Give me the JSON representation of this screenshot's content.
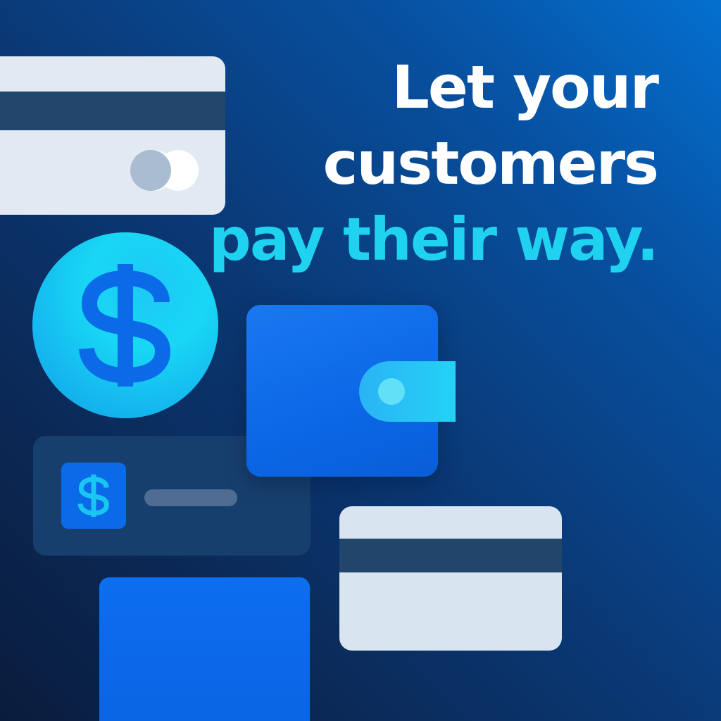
{
  "headline": {
    "line1": "Let your",
    "line2": "customers",
    "line3": "pay their way."
  },
  "colors": {
    "background_start": "#0a1c3d",
    "background_end": "#0470cf",
    "headline_white": "#ffffff",
    "headline_accent": "#1fd3f0",
    "card_light": "#e2e9f3",
    "card_stripe": "#23466d",
    "coin": "#18d7f4",
    "wallet": "#0b67e6",
    "transaction_card": "#173f6d"
  },
  "icons": {
    "coin": "dollar-coin-icon",
    "wallet": "wallet-icon",
    "transaction": "dollar-square-icon",
    "card_top": "credit-card-icon",
    "card_bottom": "credit-card-icon"
  }
}
